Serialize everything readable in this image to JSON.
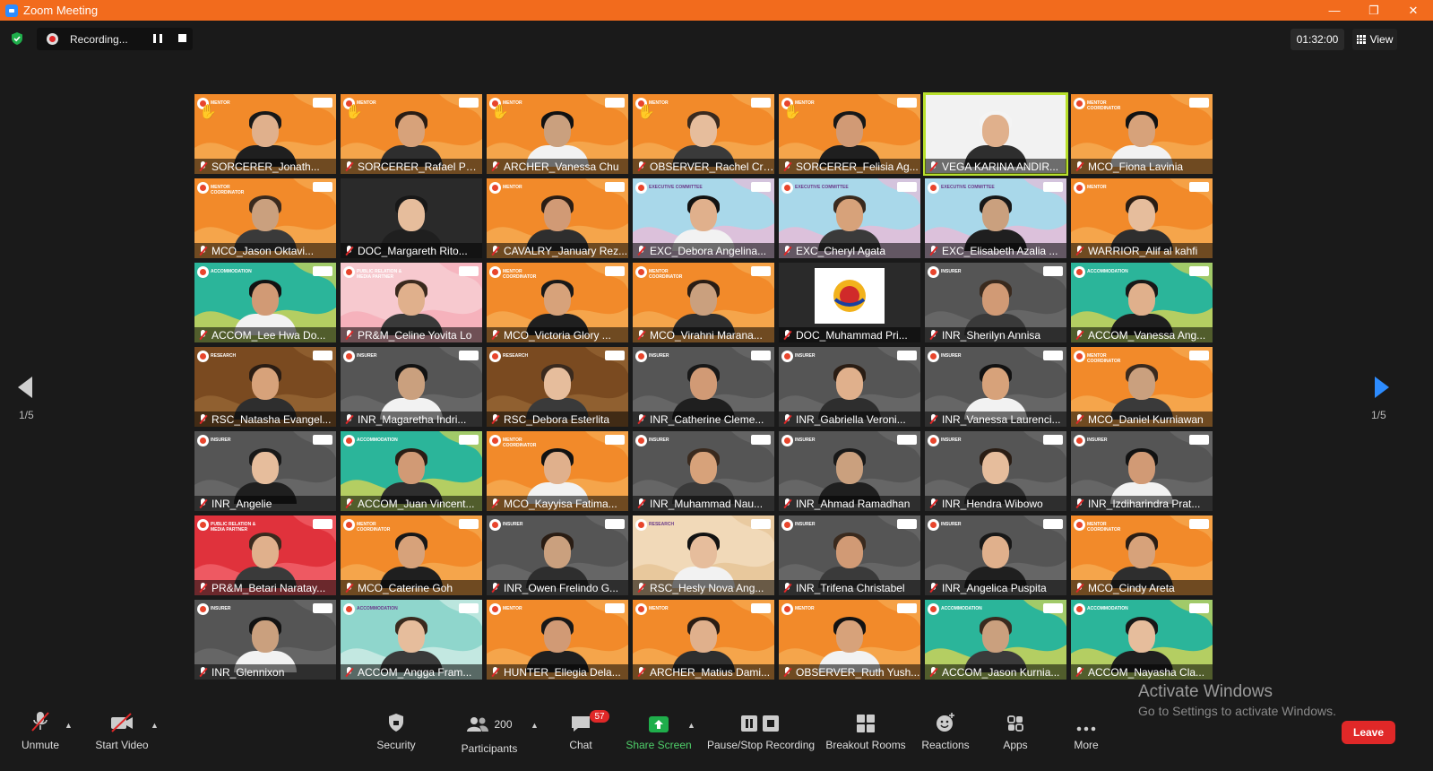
{
  "window": {
    "title": "Zoom Meeting",
    "minimize": "—",
    "restore": "❐",
    "close": "✕"
  },
  "topbar": {
    "recording_label": "Recording...",
    "timer": "01:32:00",
    "view_label": "View"
  },
  "pagination": {
    "left": "1/5",
    "right": "1/5"
  },
  "watermark": {
    "line1": "Activate Windows",
    "line2": "Go to Settings to activate Windows."
  },
  "colors": {
    "orange": "#f28a2a",
    "teal": "#2bb59a",
    "light_teal": "#8fd6cc",
    "light_blue": "#a9d8ea",
    "gray": "#555555",
    "brown": "#7a4a20",
    "pink": "#f7c9cf",
    "red": "#e0323c",
    "dark": "#2a2a2a",
    "cream": "#f1d9b8",
    "active_border": "#b8e02c"
  },
  "tiles": [
    {
      "name": "SORCERER_Jonath...",
      "bg": "orange",
      "tag": "MENTOR",
      "hand": true
    },
    {
      "name": "SORCERER_Rafael Put...",
      "bg": "orange",
      "tag": "MENTOR",
      "hand": true
    },
    {
      "name": "ARCHER_Vanessa Chu",
      "bg": "orange",
      "tag": "MENTOR",
      "hand": true
    },
    {
      "name": "OBSERVER_Rachel Cri...",
      "bg": "orange",
      "tag": "MENTOR",
      "hand": true
    },
    {
      "name": "SORCERER_Felisia Ag...",
      "bg": "orange",
      "tag": "MENTOR",
      "hand": true
    },
    {
      "name": "VEGA KARINA ANDIR...",
      "bg": "white",
      "tag": "",
      "active": true
    },
    {
      "name": "MCO_Fiona Lavinia",
      "bg": "orange",
      "tag": "MENTOR COORDINATOR"
    },
    {
      "name": "MCO_Jason Oktavi...",
      "bg": "orange",
      "tag": "MENTOR COORDINATOR"
    },
    {
      "name": "DOC_Margareth Rito...",
      "bg": "dark",
      "tag": ""
    },
    {
      "name": "CAVALRY_January Rez...",
      "bg": "orange",
      "tag": "MENTOR"
    },
    {
      "name": "EXC_Debora Angelina...",
      "bg": "light_blue",
      "tag": "EXECUTIVE COMMITTEE"
    },
    {
      "name": "EXC_Cheryl Agata",
      "bg": "light_blue",
      "tag": "EXECUTIVE COMMITTEE"
    },
    {
      "name": "EXC_Elisabeth Azalia ...",
      "bg": "light_blue",
      "tag": "EXECUTIVE COMMITTEE"
    },
    {
      "name": "WARRIOR_Alif al kahfi",
      "bg": "orange",
      "tag": "MENTOR"
    },
    {
      "name": "ACCOM_Lee Hwa Do...",
      "bg": "teal",
      "tag": "ACCOMMODATION"
    },
    {
      "name": "PR&M_Celine Yovita Lo",
      "bg": "pink",
      "tag": "PUBLIC RELATION & MEDIA PARTNER"
    },
    {
      "name": "MCO_Victoria Glory ...",
      "bg": "orange",
      "tag": "MENTOR COORDINATOR"
    },
    {
      "name": "MCO_Virahni Marana...",
      "bg": "orange",
      "tag": "MENTOR COORDINATOR"
    },
    {
      "name": "DOC_Muhammad Pri...",
      "bg": "dark",
      "tag": "",
      "logo_only": true
    },
    {
      "name": "INR_Sherilyn Annisa",
      "bg": "gray",
      "tag": "INSURER"
    },
    {
      "name": "ACCOM_Vanessa Ang...",
      "bg": "teal",
      "tag": "ACCOMMODATION"
    },
    {
      "name": "RSC_Natasha Evangel...",
      "bg": "brown",
      "tag": "RESEARCH"
    },
    {
      "name": "INR_Magaretha Indri...",
      "bg": "gray",
      "tag": "INSURER"
    },
    {
      "name": "RSC_Debora Esterlita",
      "bg": "brown",
      "tag": "RESEARCH"
    },
    {
      "name": "INR_Catherine Cleme...",
      "bg": "gray",
      "tag": "INSURER"
    },
    {
      "name": "INR_Gabriella Veroni...",
      "bg": "gray",
      "tag": "INSURER"
    },
    {
      "name": "INR_Vanessa Laurenci...",
      "bg": "gray",
      "tag": "INSURER"
    },
    {
      "name": "MCO_Daniel Kurniawan",
      "bg": "orange",
      "tag": "MENTOR COORDINATOR"
    },
    {
      "name": "INR_Angelie",
      "bg": "gray",
      "tag": "INSURER"
    },
    {
      "name": "ACCOM_Juan Vincent...",
      "bg": "teal",
      "tag": "ACCOMMODATION"
    },
    {
      "name": "MCO_Kayyisa Fatima...",
      "bg": "orange",
      "tag": "MENTOR COORDINATOR"
    },
    {
      "name": "INR_Muhammad Nau...",
      "bg": "gray",
      "tag": "INSURER"
    },
    {
      "name": "INR_Ahmad Ramadhan",
      "bg": "gray",
      "tag": "INSURER"
    },
    {
      "name": "INR_Hendra Wibowo",
      "bg": "gray",
      "tag": "INSURER"
    },
    {
      "name": "INR_Izdiharindra Prat...",
      "bg": "gray",
      "tag": "INSURER"
    },
    {
      "name": "PR&M_Betari Naratay...",
      "bg": "red",
      "tag": "PUBLIC RELATION & MEDIA PARTNER"
    },
    {
      "name": "MCO_Caterine Goh",
      "bg": "orange",
      "tag": "MENTOR COORDINATOR"
    },
    {
      "name": "INR_Owen Frelindo G...",
      "bg": "gray",
      "tag": "INSURER"
    },
    {
      "name": "RSC_Hesly Nova Ang...",
      "bg": "cream",
      "tag": "RESEARCH"
    },
    {
      "name": "INR_Trifena Christabel",
      "bg": "gray",
      "tag": "INSURER"
    },
    {
      "name": "INR_Angelica Puspita",
      "bg": "gray",
      "tag": "INSURER"
    },
    {
      "name": "MCO_Cindy Areta",
      "bg": "orange",
      "tag": "MENTOR COORDINATOR"
    },
    {
      "name": "INR_Glennixon",
      "bg": "gray",
      "tag": "INSURER"
    },
    {
      "name": "ACCOM_Angga Fram...",
      "bg": "light_teal",
      "tag": "ACCOMMODATION"
    },
    {
      "name": "HUNTER_Ellegia Dela...",
      "bg": "orange",
      "tag": "MENTOR"
    },
    {
      "name": "ARCHER_Matius Dami...",
      "bg": "orange",
      "tag": "MENTOR"
    },
    {
      "name": "OBSERVER_Ruth Yush...",
      "bg": "orange",
      "tag": "MENTOR"
    },
    {
      "name": "ACCOM_Jason Kurnia...",
      "bg": "teal",
      "tag": "ACCOMMODATION"
    },
    {
      "name": "ACCOM_Nayasha Cla...",
      "bg": "teal",
      "tag": "ACCOMMODATION"
    }
  ],
  "toolbar": {
    "unmute": "Unmute",
    "start_video": "Start Video",
    "security": "Security",
    "participants": "Participants",
    "participant_count": "200",
    "chat": "Chat",
    "chat_badge": "57",
    "share_screen": "Share Screen",
    "pause_stop_recording": "Pause/Stop Recording",
    "breakout_rooms": "Breakout Rooms",
    "reactions": "Reactions",
    "apps": "Apps",
    "more": "More",
    "leave": "Leave"
  }
}
